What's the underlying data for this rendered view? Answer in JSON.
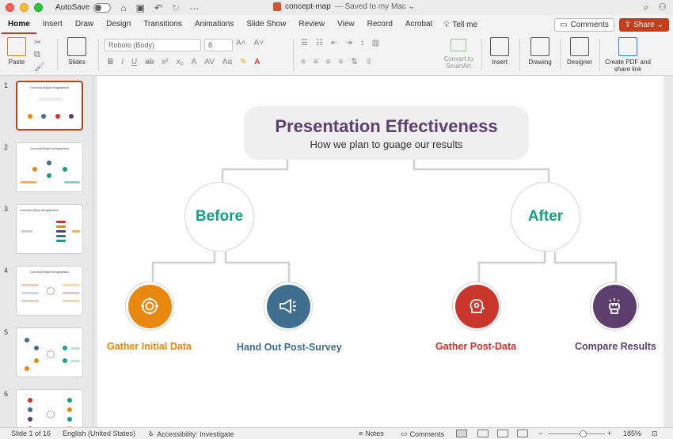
{
  "titlebar": {
    "autosave_label": "AutoSave",
    "doc_title": "concept-map",
    "doc_status": "— Saved to my Mac ⌄"
  },
  "tabs": [
    "Home",
    "Insert",
    "Draw",
    "Design",
    "Transitions",
    "Animations",
    "Slide Show",
    "Review",
    "View",
    "Record",
    "Acrobat"
  ],
  "tell_me": "Tell me",
  "comments_btn": "Comments",
  "share_btn": "Share",
  "ribbon": {
    "paste": "Paste",
    "slides": "Slides",
    "font_name": "Roboto (Body)",
    "font_size": "8",
    "convert_smartart": "Convert to SmartArt",
    "insert": "Insert",
    "drawing": "Drawing",
    "designer": "Designer",
    "create_pdf": "Create PDF and share link"
  },
  "thumbnails": [
    {
      "num": "1",
      "title": "Concept Maps Infographics",
      "selected": true
    },
    {
      "num": "2",
      "title": "Concept Maps Infographics"
    },
    {
      "num": "3",
      "title": "Concept Maps Infographics"
    },
    {
      "num": "4",
      "title": "Concept Maps Infographics"
    },
    {
      "num": "5",
      "title": ""
    },
    {
      "num": "6",
      "title": ""
    }
  ],
  "slide": {
    "title": "Presentation Effectiveness",
    "subtitle": "How we plan to guage our results",
    "before": "Before",
    "after": "After",
    "leaves": [
      {
        "label": "Gather Initial Data",
        "color": "#e8880f",
        "icon": "target-icon"
      },
      {
        "label": "Hand Out Post-Survey",
        "color": "#3f6e8e",
        "icon": "megaphone-icon"
      },
      {
        "label": "Gather Post-Data",
        "color": "#c9362c",
        "icon": "gear-head-icon"
      },
      {
        "label": "Compare Results",
        "color": "#5c3f6c",
        "icon": "fist-icon"
      }
    ]
  },
  "status": {
    "slide_pos": "Slide 1 of 16",
    "language": "English (United States)",
    "accessibility": "Accessibility: Investigate",
    "notes": "Notes",
    "comments": "Comments",
    "zoom": "185%"
  },
  "colors": {
    "accent": "#c43e1c",
    "title_purple": "#5e3f6f",
    "teal": "#15a086"
  }
}
